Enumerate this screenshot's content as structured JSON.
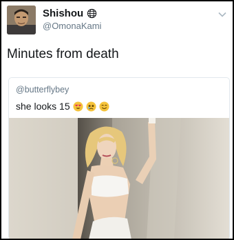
{
  "tweet": {
    "display_name": "Shishou",
    "handle": "@OmonaKami",
    "text": "Minutes from death"
  },
  "quoted": {
    "handle": "@butterflybey",
    "text": "she looks 15",
    "emojis": [
      "heart-eyes-emoji",
      "tearful-emoji",
      "smiling-emoji"
    ]
  }
}
